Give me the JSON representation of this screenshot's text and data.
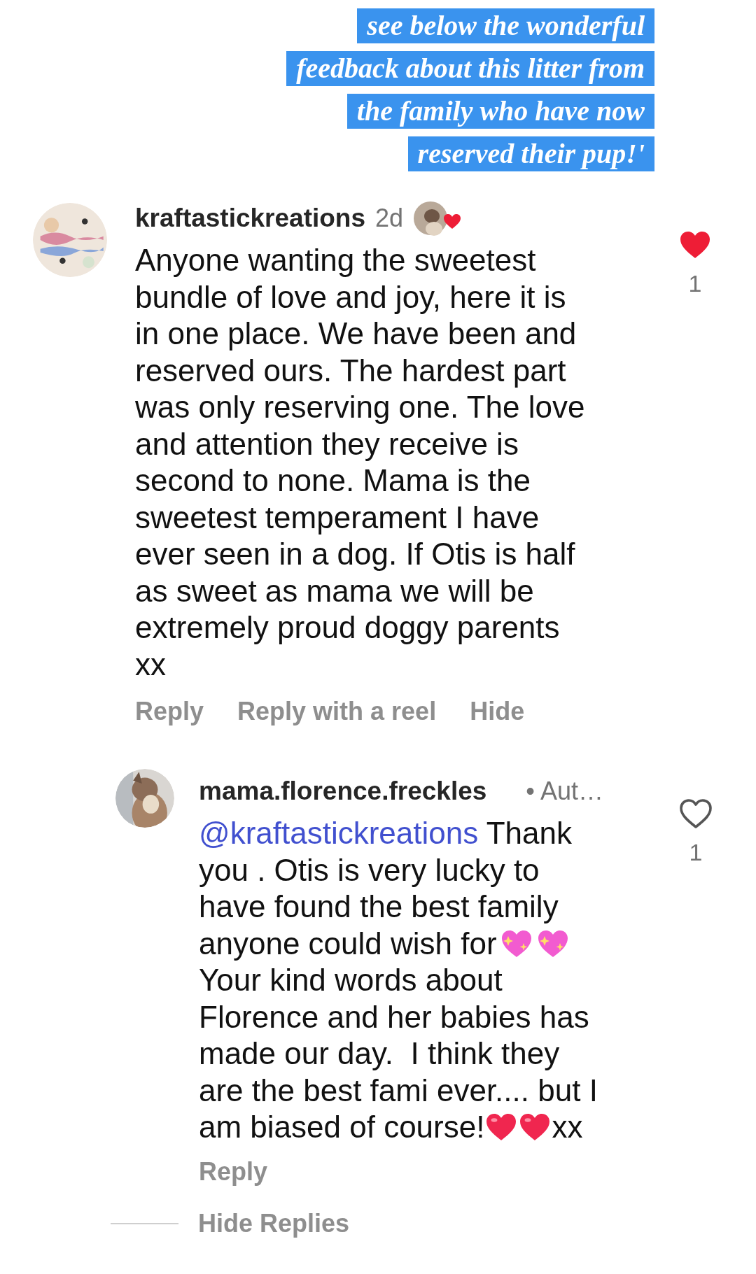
{
  "caption": {
    "lines": [
      "see below the wonderful",
      "feedback about this litter from",
      "the family who have now",
      "reserved their pup!'"
    ]
  },
  "comment": {
    "username": "kraftastickreations",
    "time": "2d",
    "liked_by_author": true,
    "liked": true,
    "like_count": "1",
    "lines": [
      "Anyone wanting the sweetest",
      "bundle of love and joy, here it is",
      "in one place. We have been and",
      "reserved ours. The hardest part",
      "was only reserving one. The love",
      "and attention they receive is",
      "second to none. Mama is the",
      "sweetest temperament I have",
      "ever seen in a dog. If Otis is half",
      "as sweet as mama we will be",
      "extremely proud doggy parents",
      "xx"
    ],
    "actions": [
      "Reply",
      "Reply with a reel",
      "Hide"
    ]
  },
  "reply": {
    "username": "mama.florence.freckles",
    "badge": "• Aut…",
    "liked": false,
    "like_count": "1",
    "lines": [
      [
        {
          "kind": "mention",
          "text": "@kraftastickreations"
        },
        {
          "kind": "text",
          "text": " Thank"
        }
      ],
      [
        {
          "kind": "text",
          "text": "you . Otis is very lucky to"
        }
      ],
      [
        {
          "kind": "text",
          "text": "have found the best family"
        }
      ],
      [
        {
          "kind": "text",
          "text": "anyone could wish for"
        },
        {
          "kind": "sparkle_heart"
        },
        {
          "kind": "sparkle_heart"
        }
      ],
      [
        {
          "kind": "text",
          "text": "Your kind words about"
        }
      ],
      [
        {
          "kind": "text",
          "text": "Florence and her babies has"
        }
      ],
      [
        {
          "kind": "text",
          "text": "made our day.  I think they"
        }
      ],
      [
        {
          "kind": "text",
          "text": "are the best fami ever.... but I"
        }
      ],
      [
        {
          "kind": "text",
          "text": "am biased of course!"
        },
        {
          "kind": "red_heart"
        },
        {
          "kind": "red_heart"
        },
        {
          "kind": "text",
          "text": "xx"
        }
      ]
    ],
    "actions": [
      "Reply"
    ]
  },
  "hide_replies": "Hide Replies"
}
